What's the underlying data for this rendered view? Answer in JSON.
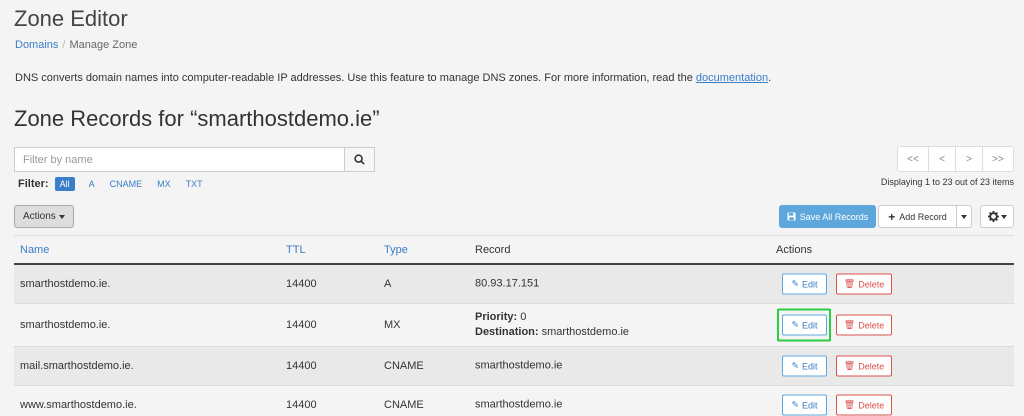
{
  "page": {
    "title": "Zone Editor",
    "breadcrumb": {
      "domains": "Domains",
      "separator": "/",
      "current": "Manage Zone"
    },
    "intro_text": "DNS converts domain names into computer-readable IP addresses. Use this feature to manage DNS zones. For more information, read the ",
    "intro_link": "documentation",
    "intro_end": ".",
    "section_title": "Zone Records for “smarthostdemo.ie”"
  },
  "search": {
    "placeholder": "Filter by name",
    "value": ""
  },
  "filter": {
    "label": "Filter:",
    "options": [
      "All",
      "A",
      "CNAME",
      "MX",
      "TXT"
    ],
    "active": "All"
  },
  "pagination": {
    "buttons": [
      "<<",
      "<",
      ">",
      ">>"
    ],
    "displaying": "Displaying 1 to 23 out of 23 items"
  },
  "toolbar": {
    "actions": "Actions",
    "save_all": "Save All Records",
    "add_record": "Add Record"
  },
  "table": {
    "headers": {
      "name": "Name",
      "ttl": "TTL",
      "type": "Type",
      "record": "Record",
      "actions": "Actions"
    },
    "edit_label": "Edit",
    "delete_label": "Delete",
    "rows": [
      {
        "name": "smarthostdemo.ie.",
        "ttl": "14400",
        "type": "A",
        "record": "80.93.17.151"
      },
      {
        "name": "smarthostdemo.ie.",
        "ttl": "14400",
        "type": "MX",
        "priority_label": "Priority:",
        "priority": "0",
        "destination_label": "Destination:",
        "destination": "smarthostdemo.ie"
      },
      {
        "name": "mail.smarthostdemo.ie.",
        "ttl": "14400",
        "type": "CNAME",
        "record": "smarthostdemo.ie"
      },
      {
        "name": "www.smarthostdemo.ie.",
        "ttl": "14400",
        "type": "CNAME",
        "record": "smarthostdemo.ie"
      }
    ]
  },
  "colors": {
    "link": "#3a7dc9",
    "primary": "#5da7dd",
    "danger": "#d9534f",
    "highlight": "#2ecc40"
  }
}
